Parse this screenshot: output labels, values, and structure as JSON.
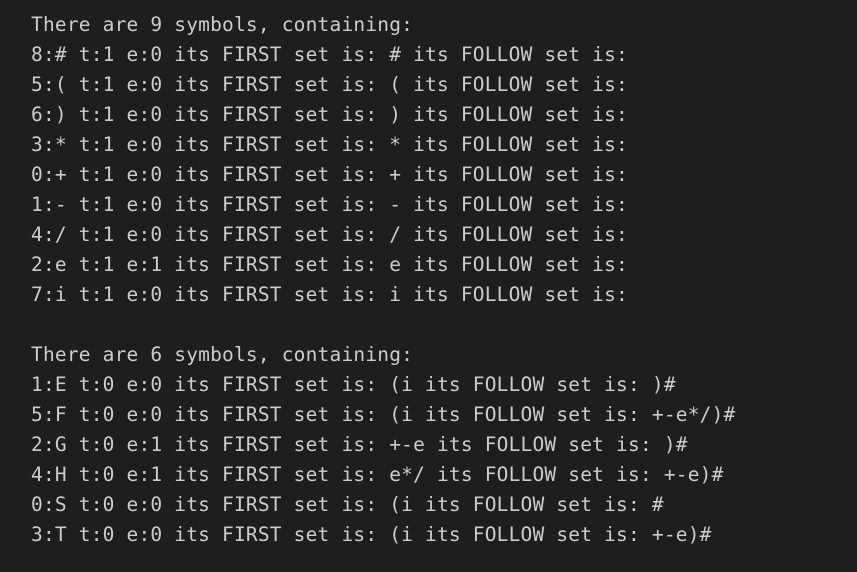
{
  "terminal": {
    "section1": {
      "header": "There are 9 symbols, containing:",
      "lines": [
        "8:# t:1 e:0 its FIRST set is: # its FOLLOW set is:",
        "5:( t:1 e:0 its FIRST set is: ( its FOLLOW set is:",
        "6:) t:1 e:0 its FIRST set is: ) its FOLLOW set is:",
        "3:* t:1 e:0 its FIRST set is: * its FOLLOW set is:",
        "0:+ t:1 e:0 its FIRST set is: + its FOLLOW set is:",
        "1:- t:1 e:0 its FIRST set is: - its FOLLOW set is:",
        "4:/ t:1 e:0 its FIRST set is: / its FOLLOW set is:",
        "2:e t:1 e:1 its FIRST set is: e its FOLLOW set is:",
        "7:i t:1 e:0 its FIRST set is: i its FOLLOW set is:"
      ]
    },
    "section2": {
      "header": "There are 6 symbols, containing:",
      "lines": [
        "1:E t:0 e:0 its FIRST set is: (i its FOLLOW set is: )#",
        "5:F t:0 e:0 its FIRST set is: (i its FOLLOW set is: +-e*/)#",
        "2:G t:0 e:1 its FIRST set is: +-e its FOLLOW set is: )#",
        "4:H t:0 e:1 its FIRST set is: e*/ its FOLLOW set is: +-e)#",
        "0:S t:0 e:0 its FIRST set is: (i its FOLLOW set is: #",
        "3:T t:0 e:0 its FIRST set is: (i its FOLLOW set is: +-e)#"
      ]
    }
  }
}
